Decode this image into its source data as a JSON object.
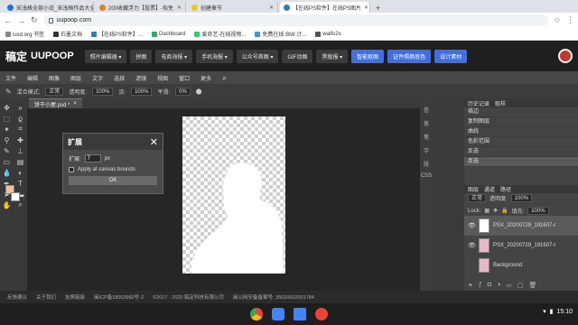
{
  "browser": {
    "tabs": [
      {
        "title": "宋浅格全部小说_宋浅格作品大全",
        "active": false,
        "color": "#1a73e8"
      },
      {
        "title": "200收藏浮力【投票】-怡免",
        "active": false,
        "color": "#e67e22"
      },
      {
        "title": "创建章节",
        "active": false,
        "color": "#f1c40f"
      },
      {
        "title": "【在线PS软件】在线PS图片",
        "active": true,
        "color": "#2980b9"
      }
    ],
    "new_tab": "+",
    "url": "uupoop.com",
    "bookmarks": [
      "iusd.org 书签",
      "石墨文档",
      "【在线PS软件】...",
      "Dashboard",
      "爱奇艺-在线视频...",
      "免费在线 BMI 计...",
      "waifu2x"
    ]
  },
  "app": {
    "logo_cn": "稿定",
    "logo_en": "UUPOOP",
    "nav": [
      "照片编辑器 ▾",
      "拼图",
      "电商海报 ▾",
      "手机海报 ▾",
      "公众号首图 ▾",
      "GIF动图",
      "黑板报 ▾"
    ],
    "nav_blue": [
      "智能抠图",
      "证件照换底色",
      "设计素材"
    ]
  },
  "menu": [
    "文件",
    "编辑",
    "图像",
    "图层",
    "文字",
    "选择",
    "滤镜",
    "视图",
    "窗口",
    "更多"
  ],
  "options": {
    "blend_label": "混合模式:",
    "blend_value": "正常",
    "opacity_label": "透明度:",
    "opacity_value": "100%",
    "flow_label": "流:",
    "flow_value": "100%",
    "smooth_label": "平滑:",
    "smooth_value": "0%"
  },
  "document": {
    "tab_title": "饼干小屋.psd *",
    "close": "×"
  },
  "dialog": {
    "title": "扩展",
    "close": "✕",
    "expand_label": "扩展:",
    "expand_value": "7",
    "unit": "px",
    "apply_label": "Apply at canvas bounds",
    "ok_label": "OK"
  },
  "sidecol": [
    "信",
    "息",
    "笔",
    "字",
    "段",
    "CSS"
  ],
  "history": {
    "tabs": [
      "历史记录",
      "取样"
    ],
    "items": [
      "描边",
      "复制图层",
      "曲线",
      "色彩范围",
      "反选",
      "反选"
    ]
  },
  "layers": {
    "tabs": [
      "图层",
      "通道",
      "路径"
    ],
    "blend": "正常",
    "opacity_label": "透明度:",
    "opacity": "100%",
    "lock_label": "Lock:",
    "fill_label": "填充:",
    "fill": "100%",
    "items": [
      {
        "name": "PSX_20200729_191607-r",
        "selected": true
      },
      {
        "name": "PSX_20200729_191607-r",
        "selected": false
      },
      {
        "name": "Background",
        "selected": false
      }
    ]
  },
  "footer": [
    "反馈建议",
    "关于我们",
    "友情链接",
    "闽ICP备18003982号-2",
    "©2017 - 2020 稿定科技有限公司",
    "闽公网安备备案号: 35020602001784"
  ],
  "shelf": {
    "time": "15:10"
  }
}
